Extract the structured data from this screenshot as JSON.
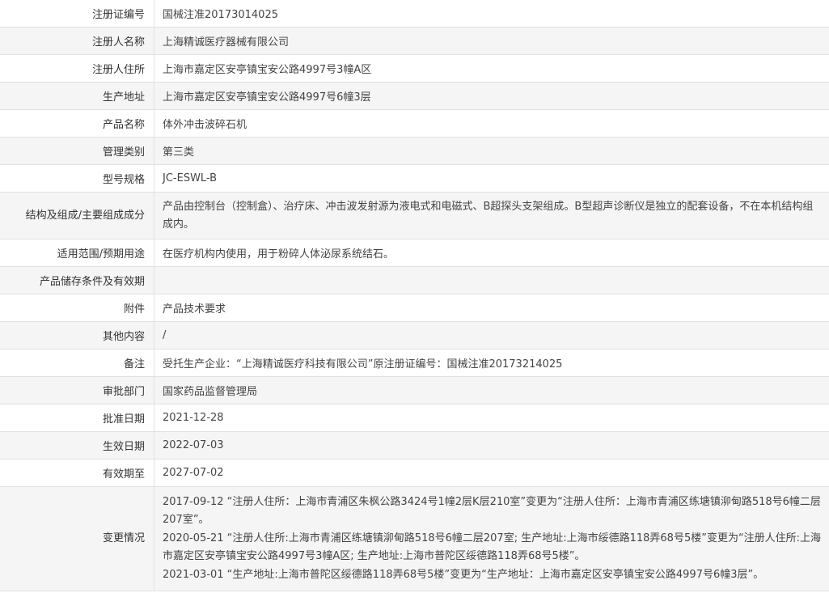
{
  "rows": [
    {
      "label": "注册证编号",
      "value": "国械注准20173014025"
    },
    {
      "label": "注册人名称",
      "value": "上海精诚医疗器械有限公司"
    },
    {
      "label": "注册人住所",
      "value": "上海市嘉定区安亭镇宝安公路4997号3幢A区"
    },
    {
      "label": "生产地址",
      "value": "上海市嘉定区安亭镇宝安公路4997号6幢3层"
    },
    {
      "label": "产品名称",
      "value": "体外冲击波碎石机"
    },
    {
      "label": "管理类别",
      "value": "第三类"
    },
    {
      "label": "型号规格",
      "value": "JC-ESWL-B"
    },
    {
      "label": "结构及组成/主要组成成分",
      "value": "产品由控制台（控制盒）、治疗床、冲击波发射源为液电式和电磁式、B超探头支架组成。B型超声诊断仪是独立的配套设备，不在本机结构组成内。"
    },
    {
      "label": "适用范围/预期用途",
      "value": "在医疗机构内使用，用于粉碎人体泌尿系统结石。"
    },
    {
      "label": "产品储存条件及有效期",
      "value": ""
    },
    {
      "label": "附件",
      "value": "产品技术要求"
    },
    {
      "label": "其他内容",
      "value": "/"
    },
    {
      "label": "备注",
      "value": "受托生产企业：“上海精诚医疗科技有限公司”原注册证编号：国械注准20173214025"
    },
    {
      "label": "审批部门",
      "value": "国家药品监督管理局"
    },
    {
      "label": "批准日期",
      "value": "2021-12-28"
    },
    {
      "label": "生效日期",
      "value": "2022-07-03"
    },
    {
      "label": "有效期至",
      "value": "2027-07-02"
    }
  ],
  "changes": {
    "label": "变更情况",
    "entries": [
      "2017-09-12 “注册人住所：上海市青浦区朱枫公路3424号1幢2层K层210室”变更为“注册人住所：上海市青浦区练塘镇泖甸路518号6幢二层207室”。",
      "2020-05-21 “注册人住所:上海市青浦区练塘镇泖甸路518号6幢二层207室; 生产地址:上海市绥德路118弄68号5楼”变更为“注册人住所:上海市嘉定区安亭镇宝安公路4997号3幢A区; 生产地址:上海市普陀区绥德路118弄68号5楼”。",
      "2021-03-01 “生产地址:上海市普陀区绥德路118弄68号5楼”变更为“生产地址：上海市嘉定区安亭镇宝安公路4997号6幢3层”。"
    ]
  }
}
